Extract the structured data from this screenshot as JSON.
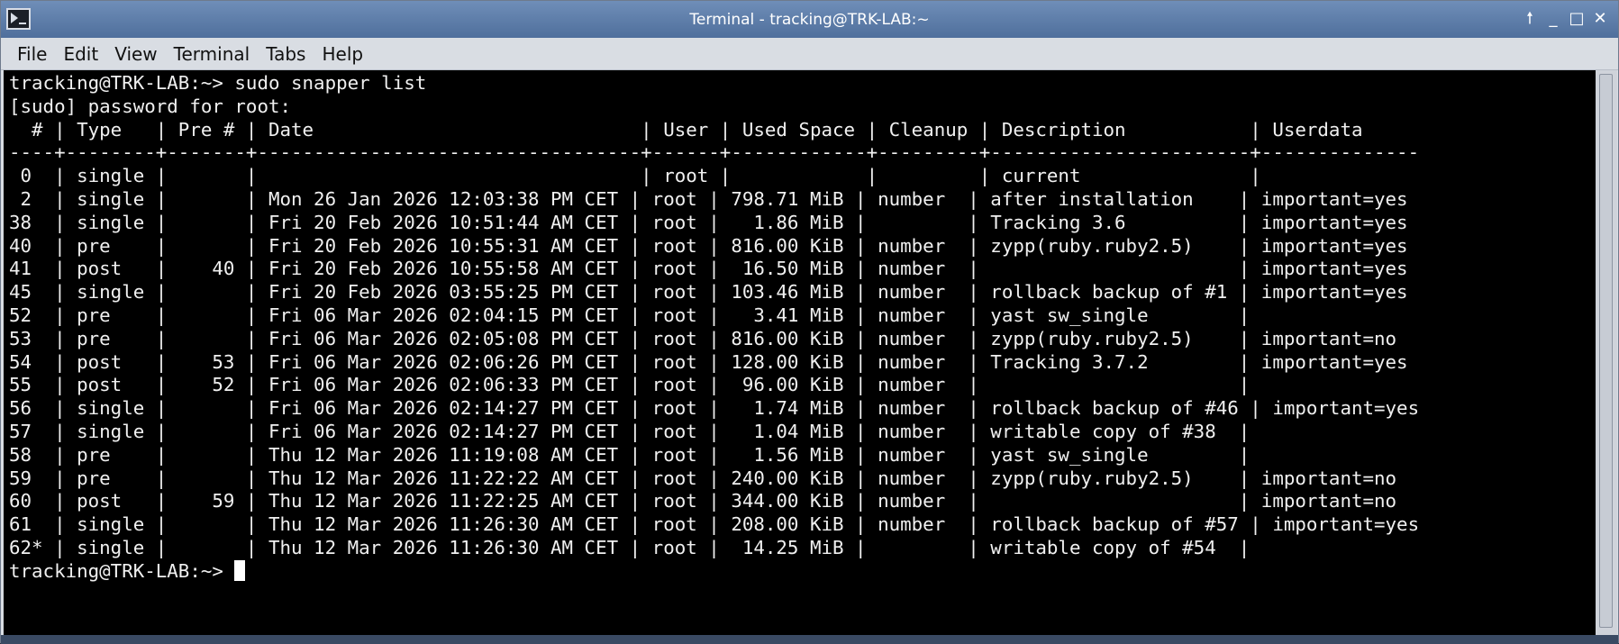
{
  "window": {
    "title": "Terminal - tracking@TRK-LAB:~",
    "buttons": {
      "sticky": "🠕",
      "minimize": "_",
      "maximize": "□",
      "close": "✕"
    }
  },
  "menu": {
    "items": [
      "File",
      "Edit",
      "View",
      "Terminal",
      "Tabs",
      "Help"
    ]
  },
  "terminal": {
    "lines": [
      "tracking@TRK-LAB:~> sudo snapper list",
      "[sudo] password for root:",
      "  # | Type   | Pre # | Date                             | User | Used Space | Cleanup | Description           | Userdata",
      "----+--------+-------+----------------------------------+------+------------+---------+-----------------------+--------------",
      " 0  | single |       |                                  | root |            |         | current               |",
      " 2  | single |       | Mon 26 Jan 2026 12:03:38 PM CET | root | 798.71 MiB | number  | after installation    | important=yes",
      "38  | single |       | Fri 20 Feb 2026 10:51:44 AM CET | root |   1.86 MiB |         | Tracking 3.6          | important=yes",
      "40  | pre    |       | Fri 20 Feb 2026 10:55:31 AM CET | root | 816.00 KiB | number  | zypp(ruby.ruby2.5)    | important=yes",
      "41  | post   |    40 | Fri 20 Feb 2026 10:55:58 AM CET | root |  16.50 MiB | number  |                       | important=yes",
      "45  | single |       | Fri 20 Feb 2026 03:55:25 PM CET | root | 103.46 MiB | number  | rollback backup of #1 | important=yes",
      "52  | pre    |       | Fri 06 Mar 2026 02:04:15 PM CET | root |   3.41 MiB | number  | yast sw_single        |",
      "53  | pre    |       | Fri 06 Mar 2026 02:05:08 PM CET | root | 816.00 KiB | number  | zypp(ruby.ruby2.5)    | important=no",
      "54  | post   |    53 | Fri 06 Mar 2026 02:06:26 PM CET | root | 128.00 KiB | number  | Tracking 3.7.2        | important=yes",
      "55  | post   |    52 | Fri 06 Mar 2026 02:06:33 PM CET | root |  96.00 KiB | number  |                       |",
      "56  | single |       | Fri 06 Mar 2026 02:14:27 PM CET | root |   1.74 MiB | number  | rollback backup of #46 | important=yes",
      "57  | single |       | Fri 06 Mar 2026 02:14:27 PM CET | root |   1.04 MiB | number  | writable copy of #38  |",
      "58  | pre    |       | Thu 12 Mar 2026 11:19:08 AM CET | root |   1.56 MiB | number  | yast sw_single        |",
      "59  | pre    |       | Thu 12 Mar 2026 11:22:22 AM CET | root | 240.00 KiB | number  | zypp(ruby.ruby2.5)    | important=no",
      "60  | post   |    59 | Thu 12 Mar 2026 11:22:25 AM CET | root | 344.00 KiB | number  |                       | important=no",
      "61  | single |       | Thu 12 Mar 2026 11:26:30 AM CET | root | 208.00 KiB | number  | rollback backup of #57 | important=yes",
      "62* | single |       | Thu 12 Mar 2026 11:26:30 AM CET | root |  14.25 MiB |         | writable copy of #54  |"
    ],
    "prompt": "tracking@TRK-LAB:~> "
  }
}
